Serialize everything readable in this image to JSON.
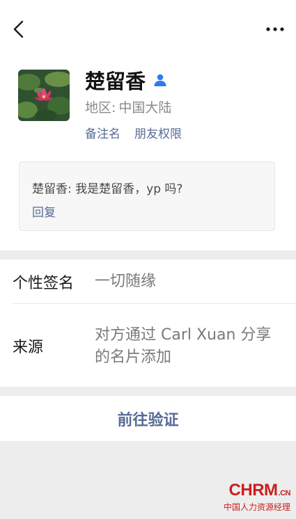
{
  "profile": {
    "name": "楚留香",
    "region_label": "地区:",
    "region_value": "中国大陆",
    "remark_link": "备注名",
    "permissions_link": "朋友权限"
  },
  "message": {
    "text": "楚留香: 我是楚留香，yp 吗?",
    "reply_label": "回复"
  },
  "info": {
    "signature_label": "个性签名",
    "signature_value": "一切随缘",
    "source_label": "来源",
    "source_line1": "对方通过 Carl Xuan 分享",
    "source_line2": "的名片添加"
  },
  "action": {
    "verify_label": "前往验证"
  },
  "watermark": {
    "brand": "CHRM",
    "domain": ".CN",
    "subtitle": "中国人力资源经理"
  },
  "colors": {
    "link": "#576b95",
    "badge": "#2b7de9",
    "watermark": "#c9201f"
  }
}
